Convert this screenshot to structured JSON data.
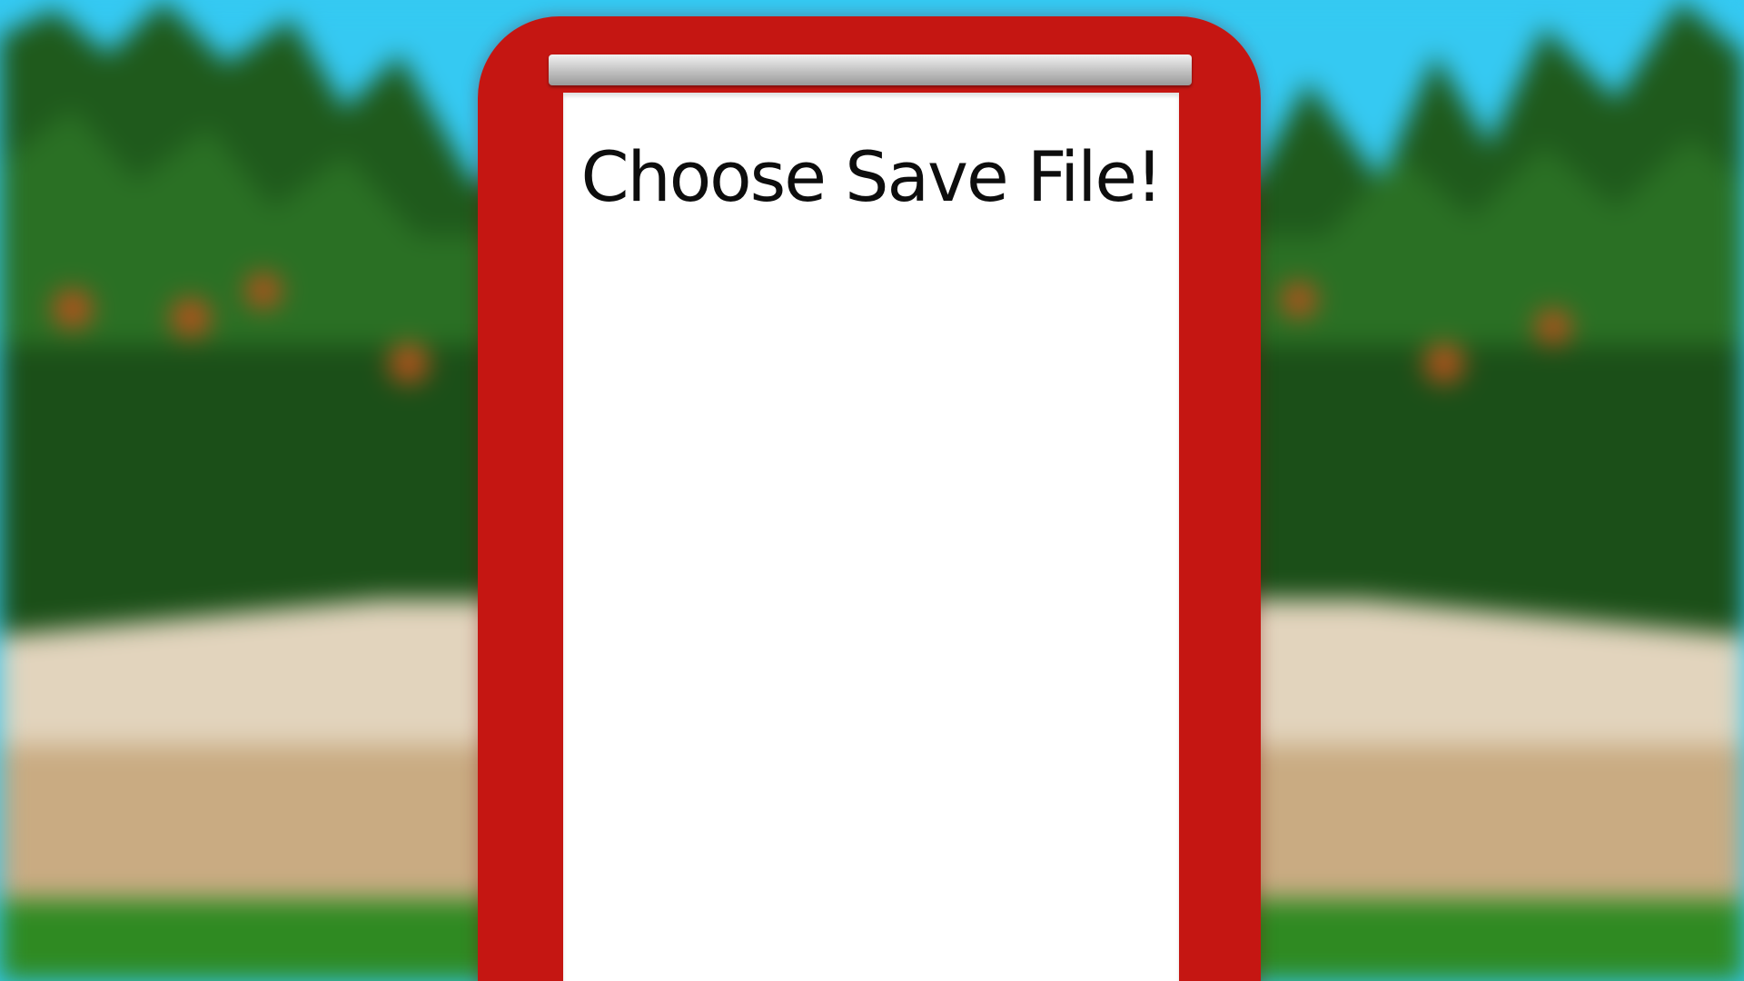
{
  "dialog": {
    "title": "Choose Save File!"
  },
  "colors": {
    "sky": "#35c9f2",
    "panel_red": "#c51612",
    "paper": "#ffffff",
    "foliage_dark": "#1f5a1c",
    "foliage_light": "#2f7f2a",
    "path_sand": "#d4c3a8",
    "grass": "#2f8a22"
  }
}
